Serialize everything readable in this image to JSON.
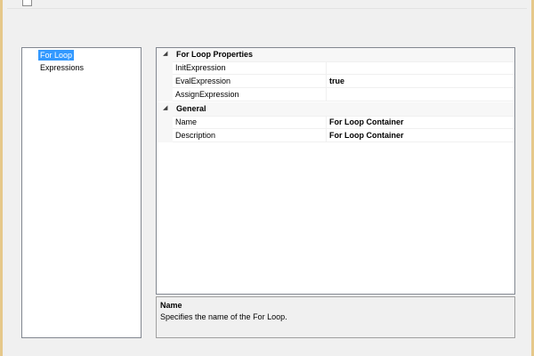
{
  "nav": {
    "items": [
      {
        "label": "For Loop",
        "selected": true
      },
      {
        "label": "Expressions",
        "selected": false
      }
    ]
  },
  "property_grid": {
    "categories": [
      {
        "label": "For Loop Properties",
        "expanded": true,
        "properties": [
          {
            "name": "InitExpression",
            "value": ""
          },
          {
            "name": "EvalExpression",
            "value": "true"
          },
          {
            "name": "AssignExpression",
            "value": ""
          }
        ]
      },
      {
        "label": "General",
        "expanded": true,
        "properties": [
          {
            "name": "Name",
            "value": "For Loop Container"
          },
          {
            "name": "Description",
            "value": "For Loop Container"
          }
        ]
      }
    ]
  },
  "description": {
    "title": "Name",
    "text": "Specifies the name of the For Loop."
  },
  "icons": {
    "category_chevron": "expanded-triangle-icon",
    "top_checkbox": "checkbox-icon"
  },
  "colors": {
    "selection": "#3399ff",
    "window_frame": "#e6c88a"
  }
}
